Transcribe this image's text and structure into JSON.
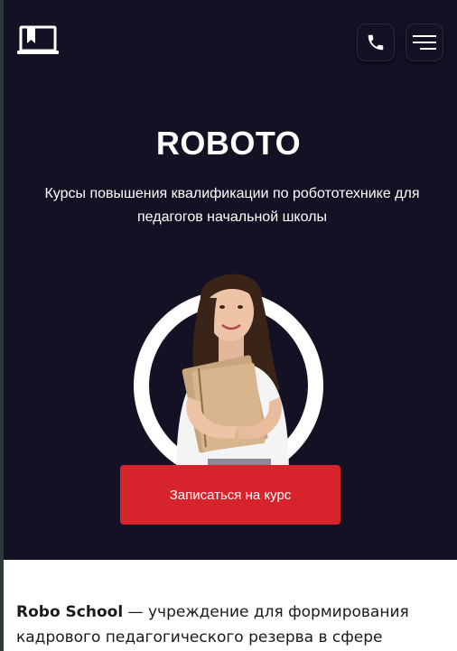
{
  "header": {
    "logo_icon": "laptop-bookmark-icon",
    "phone_icon": "phone-icon",
    "menu_icon": "hamburger-menu-icon"
  },
  "hero": {
    "title": "ROBOTO",
    "subtitle": "Курсы повышения квалификации по робототехнике для педагогов начальной школы",
    "cta_label": "Записаться на курс",
    "background_color": "#141124",
    "accent_color": "#d7232c"
  },
  "intro": {
    "brand": "Robo School",
    "text": " — учреждение для формирования кадрового педагогического резерва в сфере"
  }
}
